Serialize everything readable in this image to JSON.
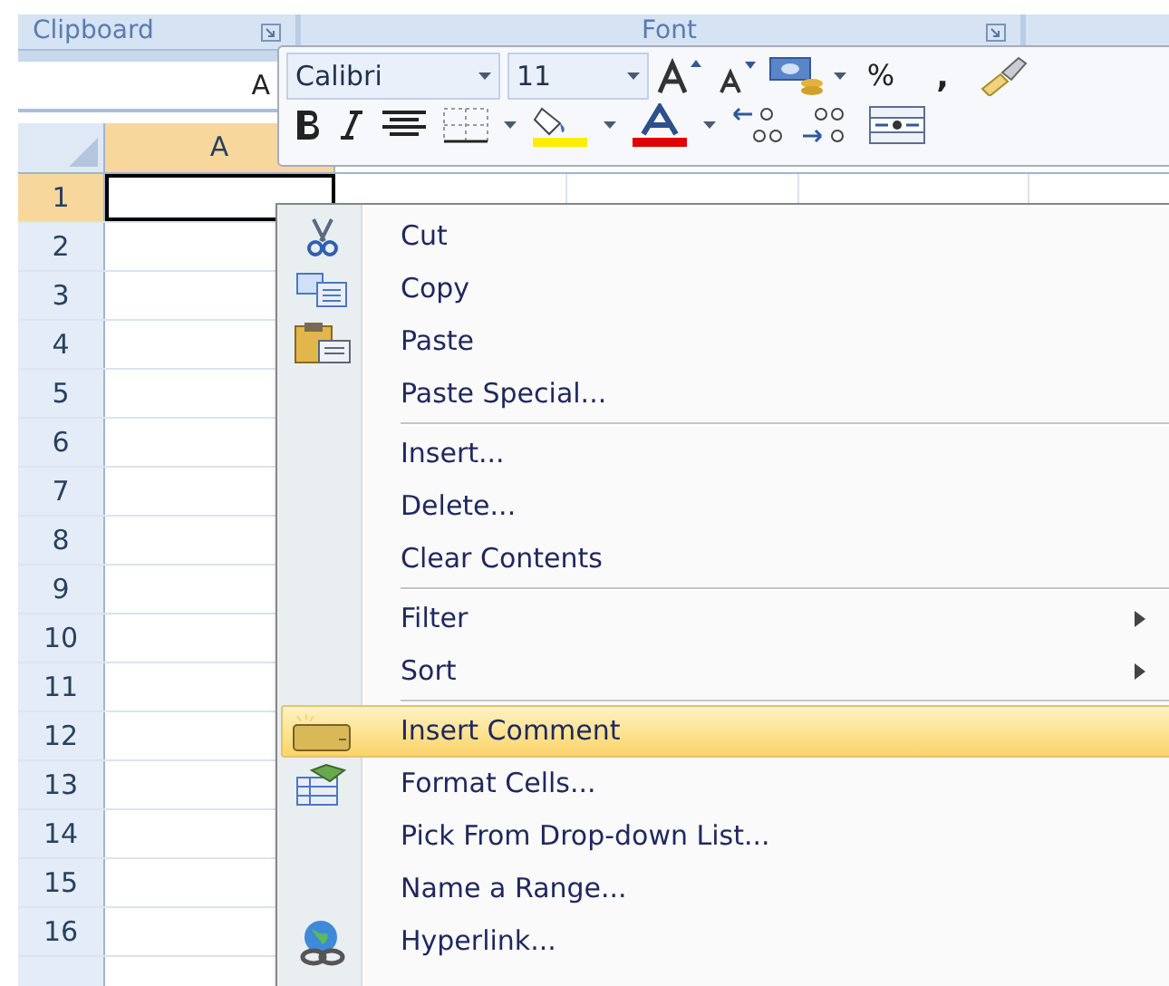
{
  "ribbon": {
    "groups": [
      {
        "label": "Clipboard"
      },
      {
        "label": "Font"
      }
    ]
  },
  "name_box": {
    "value": "A"
  },
  "sheet": {
    "columns": [
      {
        "label": "A",
        "selected": true
      }
    ],
    "rows": [
      {
        "label": "1",
        "selected": true
      },
      {
        "label": "2",
        "selected": false
      },
      {
        "label": "3",
        "selected": false
      },
      {
        "label": "4",
        "selected": false
      },
      {
        "label": "5",
        "selected": false
      },
      {
        "label": "6",
        "selected": false
      },
      {
        "label": "7",
        "selected": false
      },
      {
        "label": "8",
        "selected": false
      },
      {
        "label": "9",
        "selected": false
      },
      {
        "label": "10",
        "selected": false
      },
      {
        "label": "11",
        "selected": false
      },
      {
        "label": "12",
        "selected": false
      },
      {
        "label": "13",
        "selected": false
      },
      {
        "label": "14",
        "selected": false
      },
      {
        "label": "15",
        "selected": false
      },
      {
        "label": "16",
        "selected": false
      }
    ]
  },
  "mini_toolbar": {
    "font": "Calibri",
    "size": "11",
    "percent": "%",
    "comma": ","
  },
  "context_menu": [
    {
      "kind": "item",
      "label": "Cut",
      "submenu": false,
      "selected": false
    },
    {
      "kind": "item",
      "label": "Copy",
      "submenu": false,
      "selected": false
    },
    {
      "kind": "item",
      "label": "Paste",
      "submenu": false,
      "selected": false
    },
    {
      "kind": "item",
      "label": "Paste Special...",
      "submenu": false,
      "selected": false
    },
    {
      "kind": "separator"
    },
    {
      "kind": "item",
      "label": "Insert...",
      "submenu": false,
      "selected": false
    },
    {
      "kind": "item",
      "label": "Delete...",
      "submenu": false,
      "selected": false
    },
    {
      "kind": "item",
      "label": "Clear Contents",
      "submenu": false,
      "selected": false
    },
    {
      "kind": "separator"
    },
    {
      "kind": "item",
      "label": "Filter",
      "submenu": true,
      "selected": false
    },
    {
      "kind": "item",
      "label": "Sort",
      "submenu": true,
      "selected": false
    },
    {
      "kind": "separator"
    },
    {
      "kind": "item",
      "label": "Insert Comment",
      "submenu": false,
      "selected": true
    },
    {
      "kind": "item",
      "label": "Format Cells...",
      "submenu": false,
      "selected": false
    },
    {
      "kind": "item",
      "label": "Pick From Drop-down List...",
      "submenu": false,
      "selected": false
    },
    {
      "kind": "item",
      "label": "Name a Range...",
      "submenu": false,
      "selected": false
    },
    {
      "kind": "item",
      "label": "Hyperlink...",
      "submenu": false,
      "selected": false
    }
  ]
}
